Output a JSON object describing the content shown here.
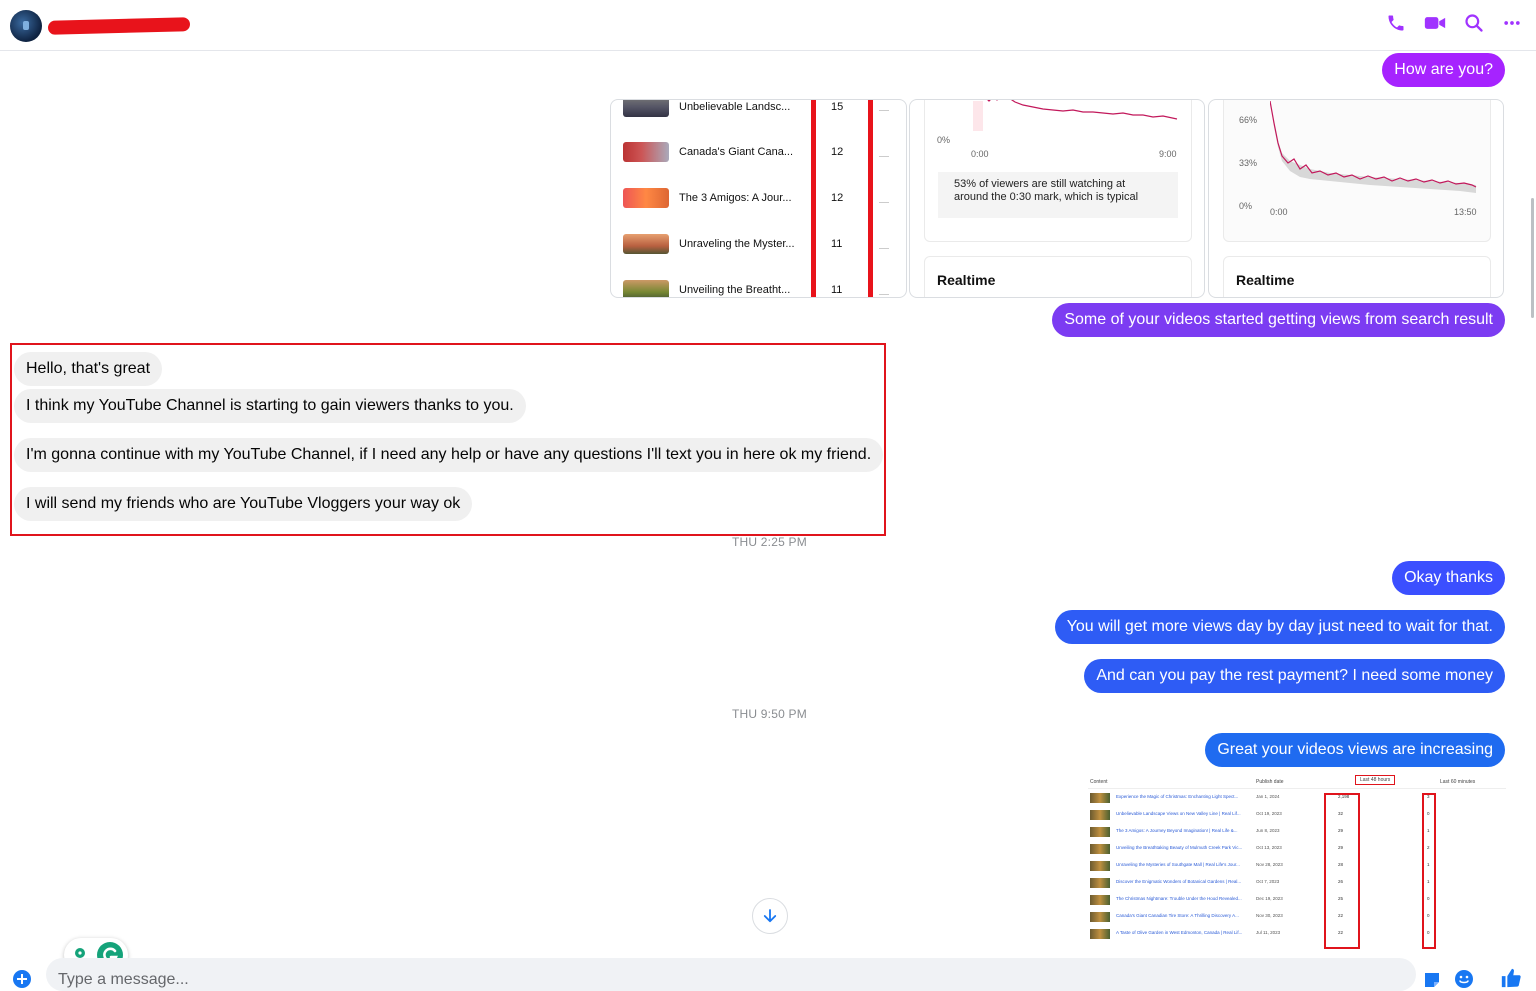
{
  "header": {
    "contact_name": "",
    "icons": [
      "phone-icon",
      "video-camera-icon",
      "search-icon",
      "more-options-icon"
    ],
    "accent_color": "#a033ff"
  },
  "messages": {
    "out_how_are_you": "How are you?",
    "out_search_result": "Some of your videos started getting views from search result",
    "in_hello": "Hello, that's great",
    "in_gain_viewers": "I think my YouTube Channel is starting to gain viewers thanks to you.",
    "in_continue": "I'm gonna continue with my YouTube Channel, if I need any help or have any questions I'll text you in here ok my friend.",
    "in_send_friends": "I will send my friends who are YouTube Vloggers your way ok",
    "ts_thu_225": "THU 2:25 PM",
    "out_okay_thanks": "Okay thanks",
    "out_more_views": "You will get more views day by day just need to wait for that.",
    "out_payment": "And can you pay the rest payment? I need some money",
    "ts_thu_950": "THU 9:50 PM",
    "out_increasing": "Great your videos views are increasing"
  },
  "analytics_card_1": {
    "videos": [
      {
        "title": "Unbelievable Landsc...",
        "value": "15"
      },
      {
        "title": "Canada's Giant Cana...",
        "value": "12"
      },
      {
        "title": "The 3 Amigos: A Jour...",
        "value": "12"
      },
      {
        "title": "Unraveling the Myster...",
        "value": "11"
      },
      {
        "title": "Unveiling the Breatht...",
        "value": "11"
      }
    ]
  },
  "analytics_card_2": {
    "y_tick": "0%",
    "x_start": "0:00",
    "x_end": "9:00",
    "note_line1": "53% of viewers are still watching at",
    "note_line2": "around the 0:30 mark, which is typical",
    "realtime_label": "Realtime"
  },
  "analytics_card_3": {
    "y_ticks": [
      "66%",
      "33%",
      "0%"
    ],
    "x_start": "0:00",
    "x_end": "13:50",
    "realtime_label": "Realtime"
  },
  "table_screenshot": {
    "headers": {
      "content": "Content",
      "publish_date": "Publish date",
      "last48": "Last 48 hours",
      "last60": "Last 60 minutes"
    },
    "rows": [
      {
        "title": "Experience the Magic of Christmas: Enchanting Light Spect...",
        "date": "Jan 1, 2024",
        "v48": "2,198",
        "v60": "3"
      },
      {
        "title": "Unbelievable Landscape Views on New Valley Line | Real Lif...",
        "date": "Oct 19, 2023",
        "v48": "32",
        "v60": "0"
      },
      {
        "title": "The 3 Amigos: A Journey Beyond Imagination! | Real Life &...",
        "date": "Jun 8, 2023",
        "v48": "29",
        "v60": "1"
      },
      {
        "title": "Unveiling the Breathtaking Beauty of Mulmuth Creek Park Vic...",
        "date": "Oct 13, 2023",
        "v48": "29",
        "v60": "2"
      },
      {
        "title": "Unraveling the Mysteries of Southgate Mall | Real Life's Jour...",
        "date": "Nov 28, 2023",
        "v48": "28",
        "v60": "1"
      },
      {
        "title": "Discover the Enigmatic Wonders of Botanical Gardens | Real...",
        "date": "Oct 7, 2023",
        "v48": "26",
        "v60": "1"
      },
      {
        "title": "The Christmas Nightmare: Trouble Under the Hood Revealed...",
        "date": "Dec 19, 2023",
        "v48": "25",
        "v60": "0"
      },
      {
        "title": "Canada's Giant Canadian Tire Store: A Thrilling Discovery A...",
        "date": "Nov 30, 2023",
        "v48": "22",
        "v60": "0"
      },
      {
        "title": "A Taste of Olive Garden in West Edmonton, Canada | Real Lif...",
        "date": "Jul 11, 2023",
        "v48": "22",
        "v60": "0"
      }
    ]
  },
  "composer": {
    "placeholder": "Type a message...",
    "icons": [
      "add-icon",
      "sticker-icon",
      "emoji-icon",
      "like-icon"
    ]
  }
}
